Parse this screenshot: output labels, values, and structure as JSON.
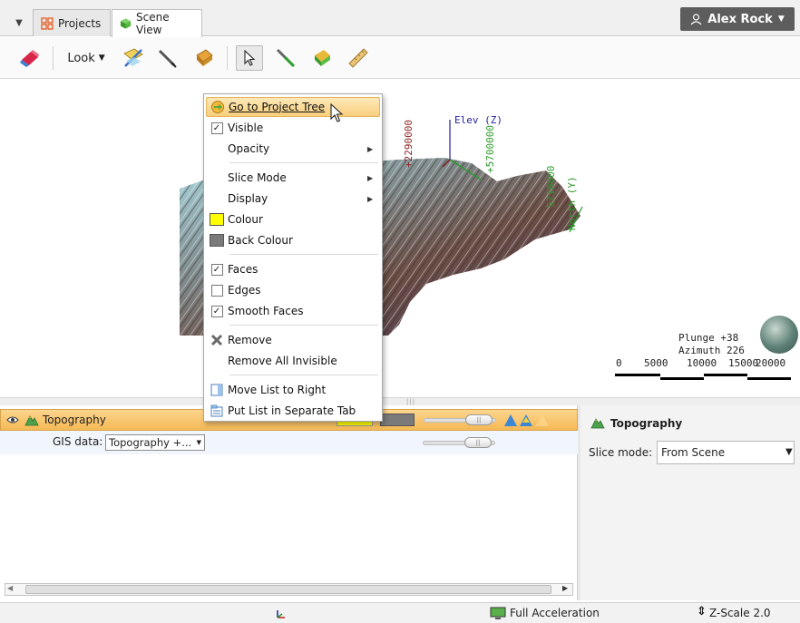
{
  "tabs": [
    {
      "label": "Projects",
      "icon": "projects-grid-icon"
    },
    {
      "label": "Scene View",
      "icon": "scene-cube-icon"
    }
  ],
  "user": {
    "name": "Alex Rock"
  },
  "toolbar": {
    "look_label": "Look"
  },
  "scene": {
    "axes": {
      "elev": "Elev (Z)",
      "y_coord": "+2290000",
      "x_coord": "+5700000",
      "north_coord": "5710000",
      "north": "North (Y)"
    },
    "plunge": "Plunge +38",
    "azimuth": "Azimuth 226",
    "scale_labels": [
      "0",
      "5000",
      "10000",
      "15000",
      "20000"
    ],
    "colors": {
      "x_axis": "#2a9a2a",
      "y_axis": "#8b1e1e",
      "z_axis": "#1e1e9b"
    }
  },
  "context_menu": {
    "items": [
      {
        "label": "Go to Project Tree",
        "icon": "go-arrow-icon",
        "highlighted": true
      },
      {
        "label": "Visible",
        "checkbox": true,
        "checked": true
      },
      {
        "label": "Opacity",
        "submenu": true
      },
      {
        "label": "Slice Mode",
        "submenu": true
      },
      {
        "label": "Display",
        "submenu": true
      },
      {
        "label": "Colour",
        "swatch": "#ffff00"
      },
      {
        "label": "Back Colour",
        "swatch": "#7a7a7a"
      },
      {
        "label": "Faces",
        "checkbox": true,
        "checked": true
      },
      {
        "label": "Edges",
        "checkbox": true,
        "checked": false
      },
      {
        "label": "Smooth Faces",
        "checkbox": true,
        "checked": true
      },
      {
        "label": "Remove",
        "icon": "remove-x-icon"
      },
      {
        "label": "Remove All Invisible"
      },
      {
        "label": "Move List to Right",
        "icon": "list-right-icon"
      },
      {
        "label": "Put List in Separate Tab",
        "icon": "list-tab-icon"
      }
    ]
  },
  "layer_list": {
    "object_name": "Topography",
    "gis_label": "GIS data:",
    "gis_value": "Topography +..."
  },
  "properties": {
    "title": "Topography",
    "slice_mode_label": "Slice mode:",
    "slice_mode_value": "From Scene"
  },
  "status": {
    "acceleration": "Full Acceleration",
    "zscale": "Z-Scale 2.0"
  },
  "colors": {
    "highlight": "#f9cf7c",
    "layer_row": "#f5b955",
    "accent_blue": "#3c86d6"
  }
}
